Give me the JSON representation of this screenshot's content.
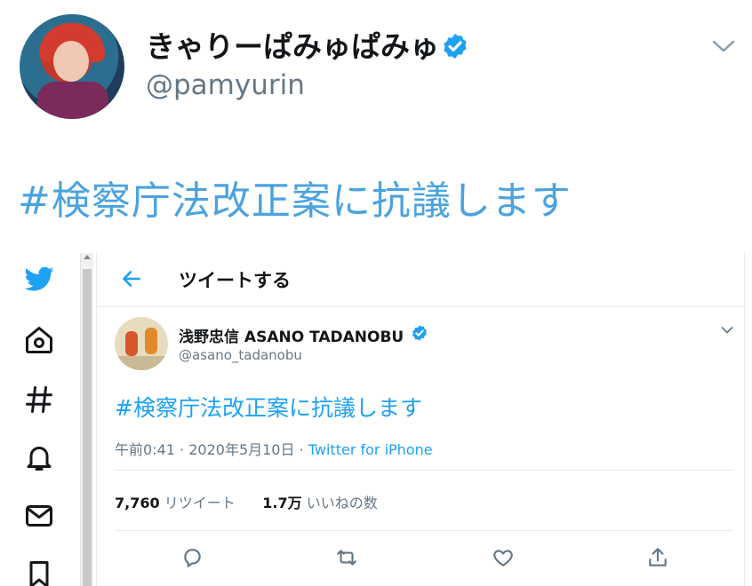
{
  "outer_tweet": {
    "display_name": "きゃりーぱみゅぱみゅ",
    "handle": "@pamyurin",
    "text": "#検察庁法改正案に抗議します"
  },
  "embedded": {
    "header": {
      "title": "ツイートする"
    },
    "tweet": {
      "display_name": "浅野忠信 ASANO TADANOBU",
      "handle": "@asano_tadanobu",
      "text": "#検察庁法改正案に抗議します",
      "time": "午前0:41",
      "separator": "·",
      "date": "2020年5月10日",
      "source": "Twitter for iPhone",
      "retweets_count": "7,760",
      "retweets_label": "リツイート",
      "likes_count": "1.7万",
      "likes_label": "いいねの数"
    }
  },
  "colors": {
    "accent": "#1da1f2",
    "outer_text": "#4aa3df",
    "secondary_text": "#657786"
  },
  "icons": {
    "nav": [
      "twitter-bird-icon",
      "home-icon",
      "hashtag-icon",
      "bell-icon",
      "mail-icon",
      "bookmark-icon"
    ],
    "actions": [
      "reply-icon",
      "retweet-icon",
      "like-icon",
      "share-icon"
    ]
  }
}
